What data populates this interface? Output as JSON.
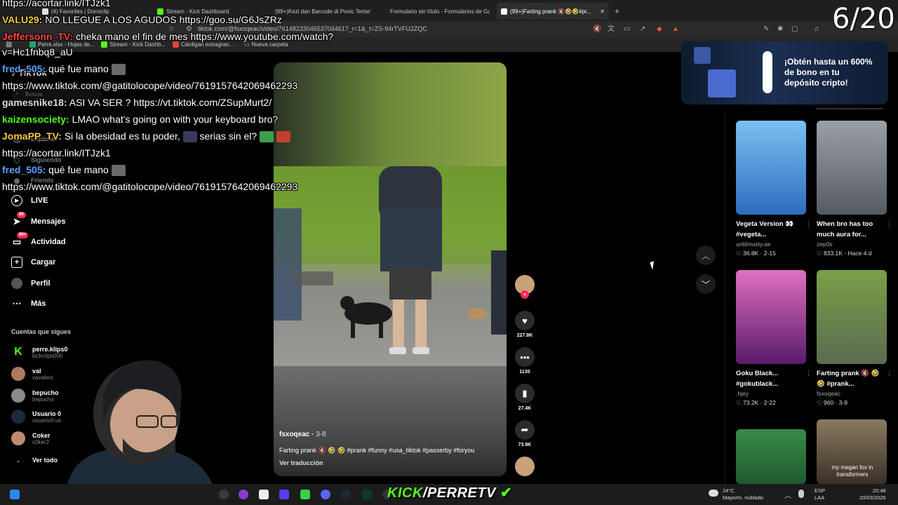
{
  "browser": {
    "tabs": [
      {
        "label": "(4) Favorites | Donoclip",
        "color": "#e0e0e0"
      },
      {
        "label": "Stream - Kick Dashboard",
        "color": "#53fc18"
      },
      {
        "label": "(99+)Kezi dan Barcode di Ponic Tertarik",
        "color": "#e0e0e0"
      },
      {
        "label": "Formulario sin título - Formularios de Goo...",
        "color": "#7248b9"
      },
      {
        "label": "(99+)Farting prank 🔇🤣🤣#pr...",
        "color": "#ffffff"
      }
    ],
    "url": "tiktok.com/@fsxoqeac/video/7614823304653704461?_r=1&_t=ZS-94rTVFU2ZQC",
    "bookmarks": [
      "Perre.xlsx - Hojas de...",
      "Stream - Kick Dashb...",
      "Cárdigan extragran...",
      "Nueva carpeta"
    ]
  },
  "sidebar": {
    "search_placeholder": "Buscar",
    "items": [
      {
        "label": "Explorar",
        "icon": "compass-icon",
        "dim": true
      },
      {
        "label": "Siguiendo",
        "icon": "following-icon",
        "dim": true
      },
      {
        "label": "Friends",
        "icon": "friends-icon",
        "dim": true
      },
      {
        "label": "LIVE",
        "icon": "live-icon",
        "dim": false
      },
      {
        "label": "Mensajes",
        "icon": "messages-icon",
        "badge": "86"
      },
      {
        "label": "Actividad",
        "icon": "activity-icon",
        "badge": "99+"
      },
      {
        "label": "Cargar",
        "icon": "upload-icon"
      },
      {
        "label": "Perfil",
        "icon": "profile-icon"
      },
      {
        "label": "Más",
        "icon": "more-icon"
      }
    ],
    "following_header": "Cuentas que sigues",
    "following": [
      {
        "name": "perre.klips0",
        "handle": "kickclips000",
        "color": "#53fc18"
      },
      {
        "name": "val",
        "handle": "vavaleni",
        "color": "#b07a60"
      },
      {
        "name": "bepucho",
        "handle": "bepucho",
        "color": "#8a8a8a"
      },
      {
        "name": "Usuario 0",
        "handle": "usuario0.us",
        "color": "#4a4a4a"
      },
      {
        "name": "Coker",
        "handle": "c0ker2",
        "color": "#c08a70"
      }
    ],
    "see_all": "Ver todo"
  },
  "video": {
    "author": "fsxoqeac",
    "date": "3-8",
    "description": "Farting prank 🔇 🤣 🤣 #prank #funny #usa_tiktok #passerby #foryou",
    "translate": "Ver traducción",
    "likes": "227.8K",
    "comments": "1130",
    "saves": "27.4K",
    "shares": "73.9K"
  },
  "ad": {
    "text": "¡Obtén hasta un 600% de bono en tu depósito cripto!"
  },
  "recommended": [
    {
      "title": "Vegeta Version 👀 #vegeta...",
      "author": "untilmusty.ae",
      "likes": "36.8K",
      "date": "2-15",
      "color": "#3f8ed8"
    },
    {
      "title": "When bro has too much aura for...",
      "author": "zep0s",
      "likes": "833.1K",
      "date": "Hace 4 d",
      "color": "#6a6f78"
    },
    {
      "title": "Goku Black... #gokublack...",
      "author": ".hjey",
      "likes": "73.2K",
      "date": "2-22",
      "color": "#b0307a"
    },
    {
      "title": "Farting prank 🔇 🤣🤣 #prank...",
      "author": "fsxoqeac",
      "likes": "960",
      "date": "3-9",
      "color": "#6f8f3a"
    },
    {
      "title": "",
      "author": "",
      "likes": "",
      "date": "",
      "color": "#2f7a3e"
    },
    {
      "title": "",
      "author": "",
      "likes": "",
      "date": "",
      "color": "#6a5a48"
    }
  ],
  "thumb_caption": "my megan fox in transformers",
  "chat": [
    {
      "user": "",
      "text": "https://acortar.link/ITJzk1",
      "color": "#ffffff"
    },
    {
      "user": "VALU29:",
      "text": " NO LLEGUE A LOS AGUDOS https://goo.su/G6JsZRz",
      "color": "#f5c842"
    },
    {
      "user": "Jeffersonn_TV:",
      "text": " cheka mano el fin de mes https://www.youtube.com/watch?",
      "color": "#ff4444"
    },
    {
      "user": "",
      "text": "v=Hc1fnbq8_aU",
      "color": "#ffffff"
    },
    {
      "user": "fred_505:",
      "text": " qué fue mano",
      "color": "#5aa0ff"
    },
    {
      "user": "",
      "text": "https://www.tiktok.com/@gatitolocope/video/7619157642069462293",
      "color": "#ffffff"
    },
    {
      "user": "gamesnike18:",
      "text": " ASI VA SER ? https://vt.tiktok.com/ZSupMurt2/",
      "color": "#dddddd"
    },
    {
      "user": "kaizensociety:",
      "text": " LMAO what's going on with your keyboard bro?",
      "color": "#53fc18"
    },
    {
      "user": "JomaPP_TV:",
      "text": " Si la obesidad es tu poder,",
      "color": "#f5c842"
    },
    {
      "user": "",
      "text": " serias sin el?",
      "color": "#ffffff"
    },
    {
      "user": "",
      "text": "https://acortar.link/ITJzk1",
      "color": "#ffffff"
    },
    {
      "user": "fred_505:",
      "text": " qué fue mano",
      "color": "#5aa0ff"
    },
    {
      "user": "",
      "text": "https://www.tiktok.com/@gatitolocope/video/7619157642069462293",
      "color": "#ffffff"
    }
  ],
  "counter": "6/20",
  "kick_banner": {
    "prefix": "KICK",
    "suffix": "/PERRETV"
  },
  "taskbar": {
    "weather_temp": "24°C",
    "weather_desc": "Mayorm. nublado",
    "lang_1": "ESP",
    "lang_2": "LAA",
    "time": "20:48",
    "date": "20/03/2026"
  },
  "colors": {
    "tiktok_red": "#fe2c55",
    "kick_green": "#53fc18"
  }
}
